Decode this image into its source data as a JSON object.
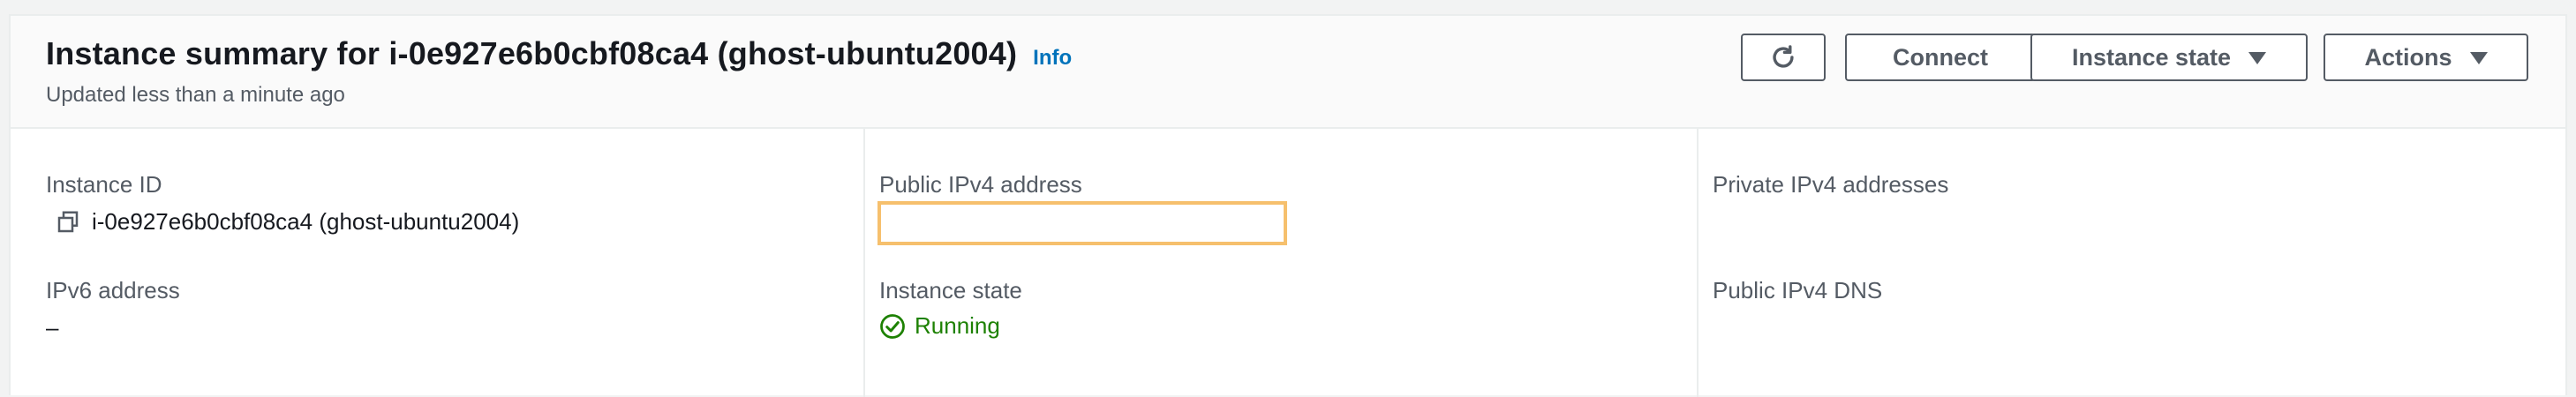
{
  "header": {
    "title": "Instance summary for i-0e927e6b0cbf08ca4 (ghost-ubuntu2004)",
    "info_link": "Info",
    "subtitle": "Updated less than a minute ago"
  },
  "toolbar": {
    "refresh_icon": "refresh-icon",
    "connect_label": "Connect",
    "instance_state_label": "Instance state",
    "actions_label": "Actions"
  },
  "details": {
    "instance_id": {
      "label": "Instance ID",
      "value": "i-0e927e6b0cbf08ca4 (ghost-ubuntu2004)"
    },
    "public_ipv4_address": {
      "label": "Public IPv4 address",
      "value": ""
    },
    "private_ipv4_addresses": {
      "label": "Private IPv4 addresses",
      "value": ""
    },
    "ipv6_address": {
      "label": "IPv6 address",
      "value": "–"
    },
    "instance_state": {
      "label": "Instance state",
      "value": "Running"
    },
    "public_ipv4_dns": {
      "label": "Public IPv4 DNS",
      "value": ""
    }
  },
  "colors": {
    "accent_link": "#0073bb",
    "running_green": "#1d8102",
    "highlight_orange": "#f6c06d",
    "button_border": "#545b64"
  }
}
